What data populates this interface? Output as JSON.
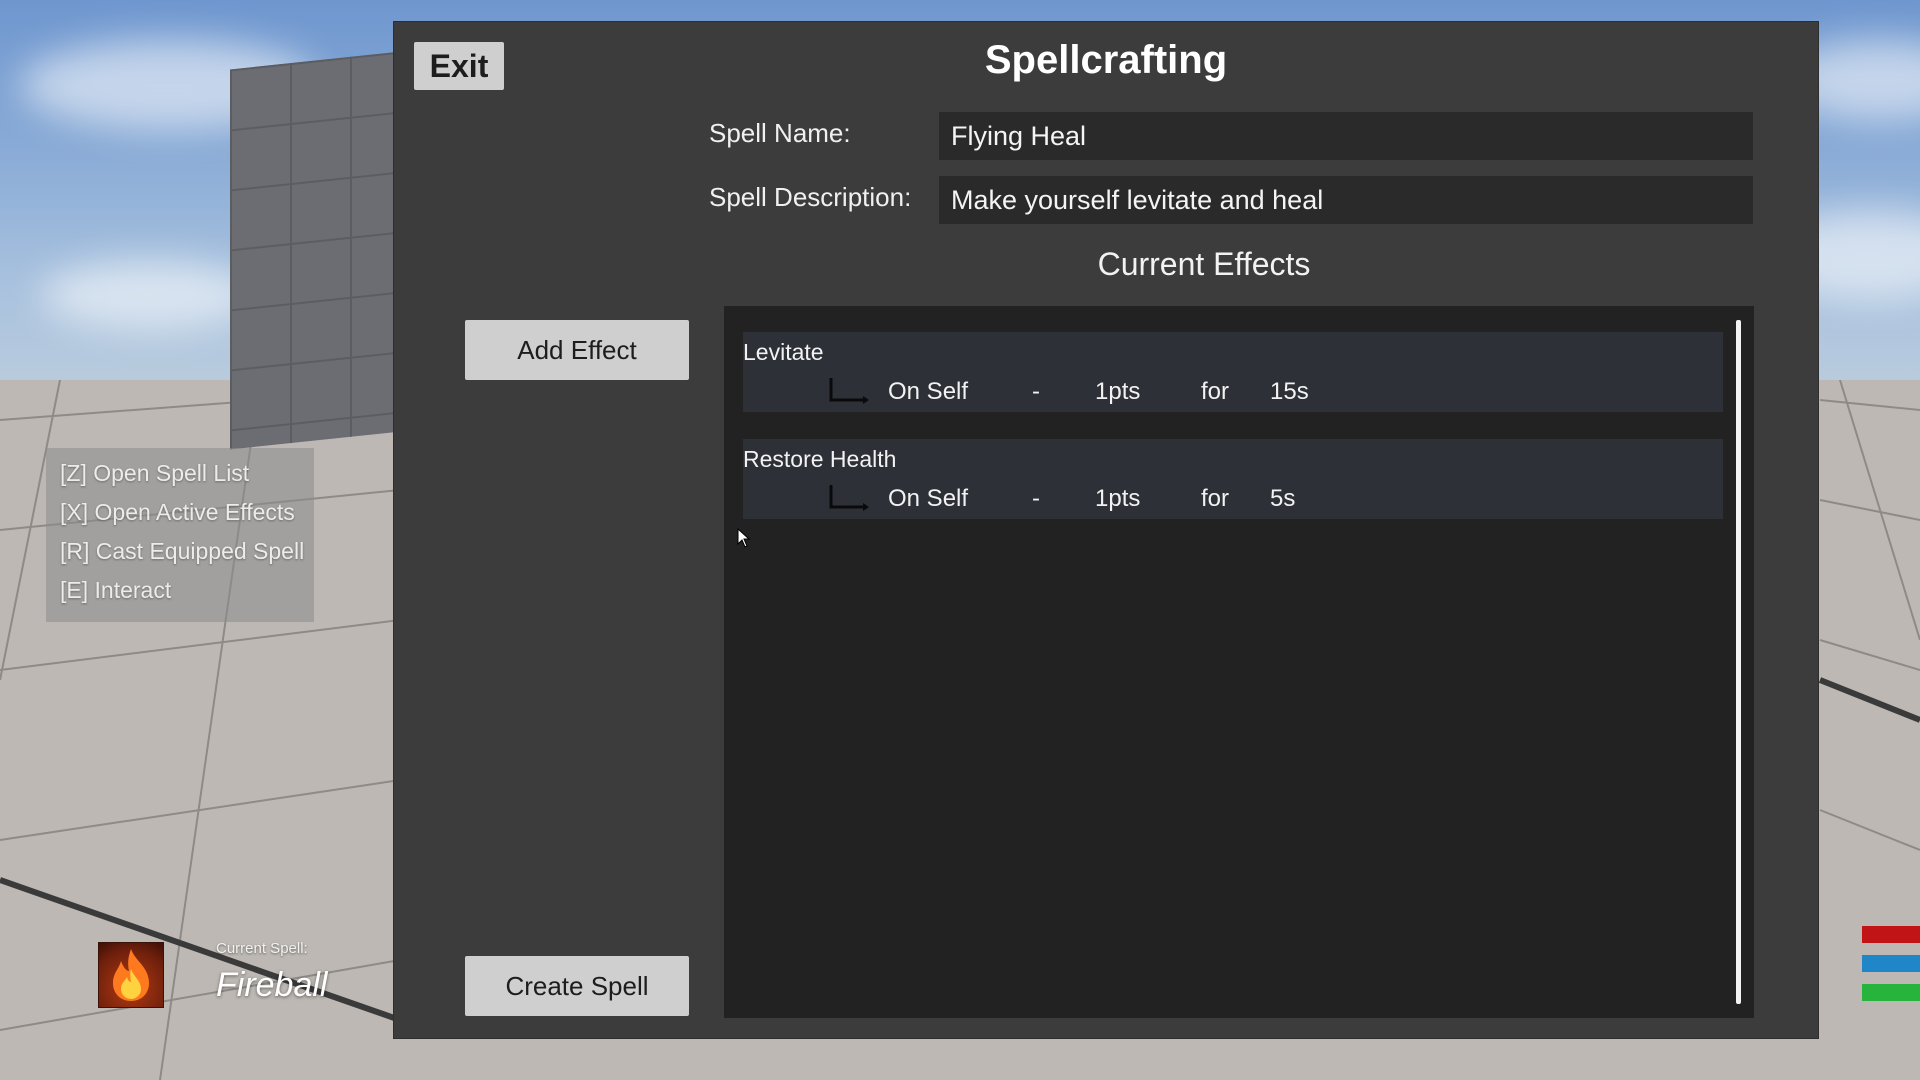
{
  "hud": {
    "hints": [
      "[Z] Open Spell List",
      "[X] Open Active Effects",
      "[R] Cast Equipped Spell",
      "[E] Interact"
    ],
    "current_spell_label": "Current Spell:",
    "current_spell_name": "Fireball",
    "current_spell_icon": "fire-icon",
    "bars": {
      "health_color": "#c01417",
      "mana_color": "#1f86c8",
      "stamina_color": "#27b43c"
    }
  },
  "panel": {
    "exit_label": "Exit",
    "title": "Spellcrafting",
    "spell_name_label": "Spell Name:",
    "spell_name_value": "Flying Heal",
    "spell_description_label": "Spell Description:",
    "spell_description_value": "Make yourself levitate and heal",
    "current_effects_heading": "Current Effects",
    "add_effect_label": "Add Effect",
    "create_spell_label": "Create Spell",
    "effects": [
      {
        "name": "Levitate",
        "target": "On Self",
        "separator": "-",
        "magnitude": "1pts",
        "for_word": "for",
        "duration": "15s"
      },
      {
        "name": "Restore Health",
        "target": "On Self",
        "separator": "-",
        "magnitude": "1pts",
        "for_word": "for",
        "duration": "5s"
      }
    ]
  },
  "colors": {
    "panel_bg": "#3c3c3c",
    "list_bg": "#222222",
    "effect_row_bg": "#2d3036",
    "button_bg": "#cfcfcf"
  }
}
